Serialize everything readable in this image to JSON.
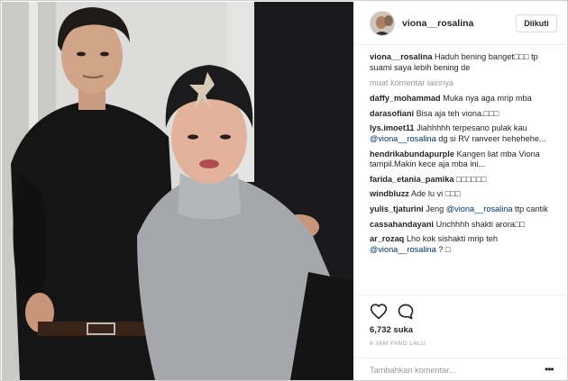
{
  "post": {
    "username": "viona__rosalina",
    "follow_label": "Diikuti",
    "more_comments_label": "muat komentar lainnya",
    "likes": "6,732 suka",
    "timestamp": "8 JAM YANG LALU",
    "add_comment_placeholder": "Tambahkan komentar...",
    "options_glyph": "•••"
  },
  "comments": [
    {
      "user": "viona__rosalina",
      "text": "Haduh bening banget□□□ tp suami saya lebih bening de"
    },
    {
      "user": "daffy_mohammad",
      "text": "Muka nya aga mrip mba"
    },
    {
      "user": "darasofiani",
      "text": "Bisa aja teh viona.□□□"
    },
    {
      "user": "lys.imoet11",
      "text": "Jiahhhhh terpesano pulak kau ",
      "mention": "@viona__rosalina",
      "text_after": " dg si RV ranveer hehehehe..."
    },
    {
      "user": "hendrikabundapurple",
      "text": "Kangen liat mba Viona tampil.Makin kece aja mba ini..."
    },
    {
      "user": "farida_etania_pamika",
      "text": "□□□□□□"
    },
    {
      "user": "windbluzz",
      "text": "Ade lu vi □□□"
    },
    {
      "user": "yulis_tjaturini",
      "text": "Jeng ",
      "mention": "@viona__rosalina",
      "text_after": " ttp cantik"
    },
    {
      "user": "cassahandayani",
      "text": "Unchhhh shakti arora□□"
    },
    {
      "user": "ar_rozaq",
      "text": "Lho kok sishakti mrip teh ",
      "mention": "@viona__rosalina",
      "text_after": " ? □"
    }
  ],
  "colors": {
    "mention": "#003569",
    "muted": "#999999",
    "border": "#efefef"
  },
  "icons": {
    "like": "heart-outline-icon",
    "comment": "speech-bubble-icon",
    "options": "more-options-icon"
  }
}
